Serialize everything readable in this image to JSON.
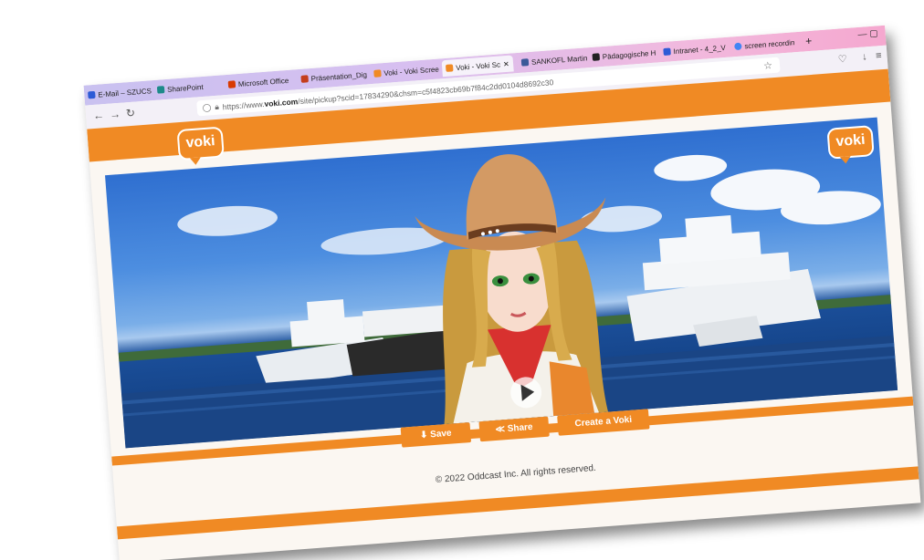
{
  "browser": {
    "tabs": [
      {
        "label": "E-Mail – SZUCS",
        "color": "#2d5bd6"
      },
      {
        "label": "SharePoint",
        "color": "#1d8a8a"
      },
      {
        "label": "Microsoft Office",
        "color": "#d83b01"
      },
      {
        "label": "Präsentation_Dig",
        "color": "#c43e1c"
      },
      {
        "label": "Voki - Voki Scree",
        "color": "#f08a24"
      },
      {
        "label": "Voki - Voki Sc",
        "color": "#f08a24",
        "active": true
      },
      {
        "label": "SANKOFL Martin",
        "color": "#3b5998"
      },
      {
        "label": "Pädagogische H",
        "color": "#222222"
      },
      {
        "label": "Intranet - 4_2_V",
        "color": "#2d5bd6"
      },
      {
        "label": "screen recordin",
        "color": "#4285f4"
      }
    ],
    "new_tab": "+",
    "url_prefix": "https://www.",
    "url_domain": "voki.com",
    "url_path": "/site/pickup?scid=17834290&chsm=c5f4823cb69b7f84c2dd0104d8692c30"
  },
  "site": {
    "logo_text": "voki",
    "buttons": {
      "save": "⬇ Save",
      "share": "≪ Share",
      "create": "Create a Voki"
    },
    "copyright": "© 2022 Oddcast Inc. All rights reserved."
  },
  "colors": {
    "brand_orange": "#f08a24"
  }
}
